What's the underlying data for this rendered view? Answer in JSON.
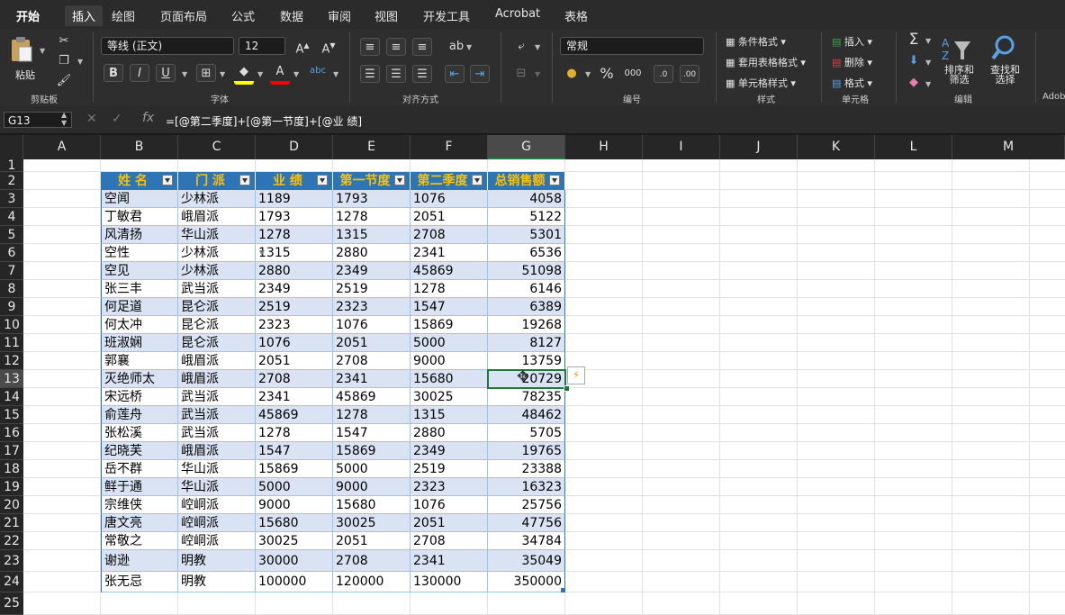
{
  "menu": {
    "tabs": [
      "开始",
      "插入",
      "绘图",
      "页面布局",
      "公式",
      "数据",
      "审阅",
      "视图",
      "开发工具",
      "Acrobat",
      "表格"
    ],
    "active": "开始",
    "selected": "插入"
  },
  "ribbon": {
    "paste_label": "粘贴",
    "clipboard_label": "剪贴板",
    "font_name": "等线 (正文)",
    "font_size": "12",
    "font_group_label": "字体",
    "bold": "B",
    "italic": "I",
    "underline": "U",
    "align_group_label": "对齐方式",
    "number_format": "常规",
    "number_group_label": "编号",
    "percent": "%",
    "thousands": "000",
    "style_items": [
      "条件格式",
      "套用表格格式",
      "单元格样式"
    ],
    "style_group_label": "样式",
    "cell_items": [
      "插入",
      "删除",
      "格式"
    ],
    "cell_group_label": "单元格",
    "sort_label": "排序和\n筛选",
    "find_label": "查找和\n选择",
    "edit_group_label": "编辑",
    "adobe_label": "Adob"
  },
  "formula_bar": {
    "name_box": "G13",
    "fx": "fx",
    "formula": "=[@第二季度]+[@第一节度]+[@业  绩]"
  },
  "sheet": {
    "columns": [
      "A",
      "B",
      "C",
      "D",
      "E",
      "F",
      "G",
      "H",
      "I",
      "J",
      "K",
      "L",
      "M"
    ],
    "selected_column": "G",
    "selected_row": "13",
    "rows": [
      "1",
      "2",
      "3",
      "4",
      "5",
      "6",
      "7",
      "8",
      "9",
      "10",
      "11",
      "12",
      "13",
      "14",
      "15",
      "16",
      "17",
      "18",
      "19",
      "20",
      "21",
      "22",
      "23",
      "24",
      "25"
    ],
    "table_headers": [
      "姓  名",
      "门  派",
      "业  绩",
      "第一节度",
      "第二季度",
      "总销售额"
    ],
    "table_rows": [
      [
        "空闻",
        "少林派",
        "1189",
        "1793",
        "1076",
        "4058"
      ],
      [
        "丁敏君",
        "峨眉派",
        "1793",
        "1278",
        "2051",
        "5122"
      ],
      [
        "风清扬",
        "华山派",
        "1278",
        "1315",
        "2708",
        "5301"
      ],
      [
        "空性",
        "少林派",
        "1315",
        "2880",
        "2341",
        "6536"
      ],
      [
        "空见",
        "少林派",
        "2880",
        "2349",
        "45869",
        "51098"
      ],
      [
        "张三丰",
        "武当派",
        "2349",
        "2519",
        "1278",
        "6146"
      ],
      [
        "何足道",
        "昆仑派",
        "2519",
        "2323",
        "1547",
        "6389"
      ],
      [
        "何太冲",
        "昆仑派",
        "2323",
        "1076",
        "15869",
        "19268"
      ],
      [
        "班淑娴",
        "昆仑派",
        "1076",
        "2051",
        "5000",
        "8127"
      ],
      [
        "郭襄",
        "峨眉派",
        "2051",
        "2708",
        "9000",
        "13759"
      ],
      [
        "灭绝师太",
        "峨眉派",
        "2708",
        "2341",
        "15680",
        "20729"
      ],
      [
        "宋远桥",
        "武当派",
        "2341",
        "45869",
        "30025",
        "78235"
      ],
      [
        "俞莲舟",
        "武当派",
        "45869",
        "1278",
        "1315",
        "48462"
      ],
      [
        "张松溪",
        "武当派",
        "1278",
        "1547",
        "2880",
        "5705"
      ],
      [
        "纪晓芙",
        "峨眉派",
        "1547",
        "15869",
        "2349",
        "19765"
      ],
      [
        "岳不群",
        "华山派",
        "15869",
        "5000",
        "2519",
        "23388"
      ],
      [
        "鲜于通",
        "华山派",
        "5000",
        "9000",
        "2323",
        "16323"
      ],
      [
        "宗维侠",
        "崆峒派",
        "9000",
        "15680",
        "1076",
        "25756"
      ],
      [
        "唐文亮",
        "崆峒派",
        "15680",
        "30025",
        "2051",
        "47756"
      ],
      [
        "常敬之",
        "崆峒派",
        "30025",
        "2051",
        "2708",
        "34784"
      ],
      [
        "谢逊",
        "明教",
        "30000",
        "2708",
        "2341",
        "35049"
      ],
      [
        "张无忌",
        "明教",
        "100000",
        "120000",
        "130000",
        "350000"
      ]
    ],
    "colors": {
      "header_bg": "#2e75b6",
      "header_text": "#ffc000",
      "band": "#dae3f3",
      "select": "#1b7a3a"
    }
  }
}
